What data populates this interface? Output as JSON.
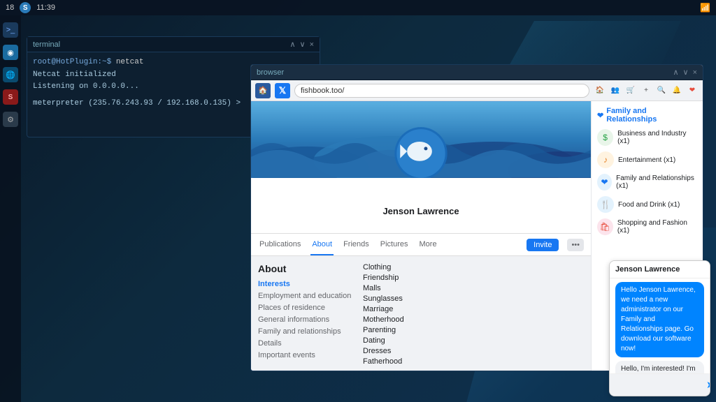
{
  "taskbar": {
    "number": "18",
    "time": "11:39",
    "logo_text": "S"
  },
  "terminal": {
    "title": "terminal",
    "controls": "∧ ∨ ×",
    "line1": "root@HotPlugin:~$ netcat",
    "line2": "Netcat initialized",
    "line3": "Listening on 0.0.0.0...",
    "line4": "",
    "line5": "meterpreter (235.76.243.93 / 192.168.0.135) >"
  },
  "browser": {
    "title": "browser",
    "controls": "∧ ∨ ×",
    "url": "fishbook.too/",
    "profile_name": "Jenson Lawrence",
    "nav_items": [
      "Publications",
      "About",
      "Friends",
      "Pictures",
      "More"
    ],
    "active_nav": "About",
    "invite_label": "Invite",
    "about": {
      "title": "About",
      "section_active": "Interests",
      "sections": [
        "Employment and education",
        "Places of residence",
        "General informations",
        "Family and relationships",
        "Details",
        "Important events"
      ],
      "interests": [
        "Clothing",
        "Friendship",
        "Malls",
        "Sunglasses",
        "Marriage",
        "Motherhood",
        "Parenting",
        "Dating",
        "Dresses",
        "Fatherhood"
      ]
    },
    "sidebar_panel": {
      "title": "Family and Relationships",
      "categories": [
        {
          "icon": "$",
          "label": "Business and Industry (x1)",
          "color": "#25a244"
        },
        {
          "icon": "🎵",
          "label": "Entertainment (x1)",
          "color": "#e67e22"
        },
        {
          "icon": "❤",
          "label": "Family and Relationships (x1)",
          "color": "#1877f2"
        },
        {
          "icon": "🍴",
          "label": "Food and Drink (x1)",
          "color": "#1877f2"
        },
        {
          "icon": "🛍",
          "label": "Shopping and Fashion (x1)",
          "color": "#e74c3c"
        }
      ]
    },
    "messenger": {
      "contact": "Jenson Lawrence",
      "msg1": "Hello Jenson Lawrence, we need a new administrator on our Family and Relationships page. Go download our software now!",
      "msg2": "Hello, I'm interested! I'm doing it right now!",
      "input_placeholder": ""
    }
  },
  "sidebar": {
    "icons": [
      {
        "name": "terminal",
        "char": ">_"
      },
      {
        "name": "shield",
        "char": "◉"
      },
      {
        "name": "globe",
        "char": "🌐"
      },
      {
        "name": "security",
        "char": "S"
      },
      {
        "name": "settings",
        "char": "⚙"
      }
    ]
  }
}
